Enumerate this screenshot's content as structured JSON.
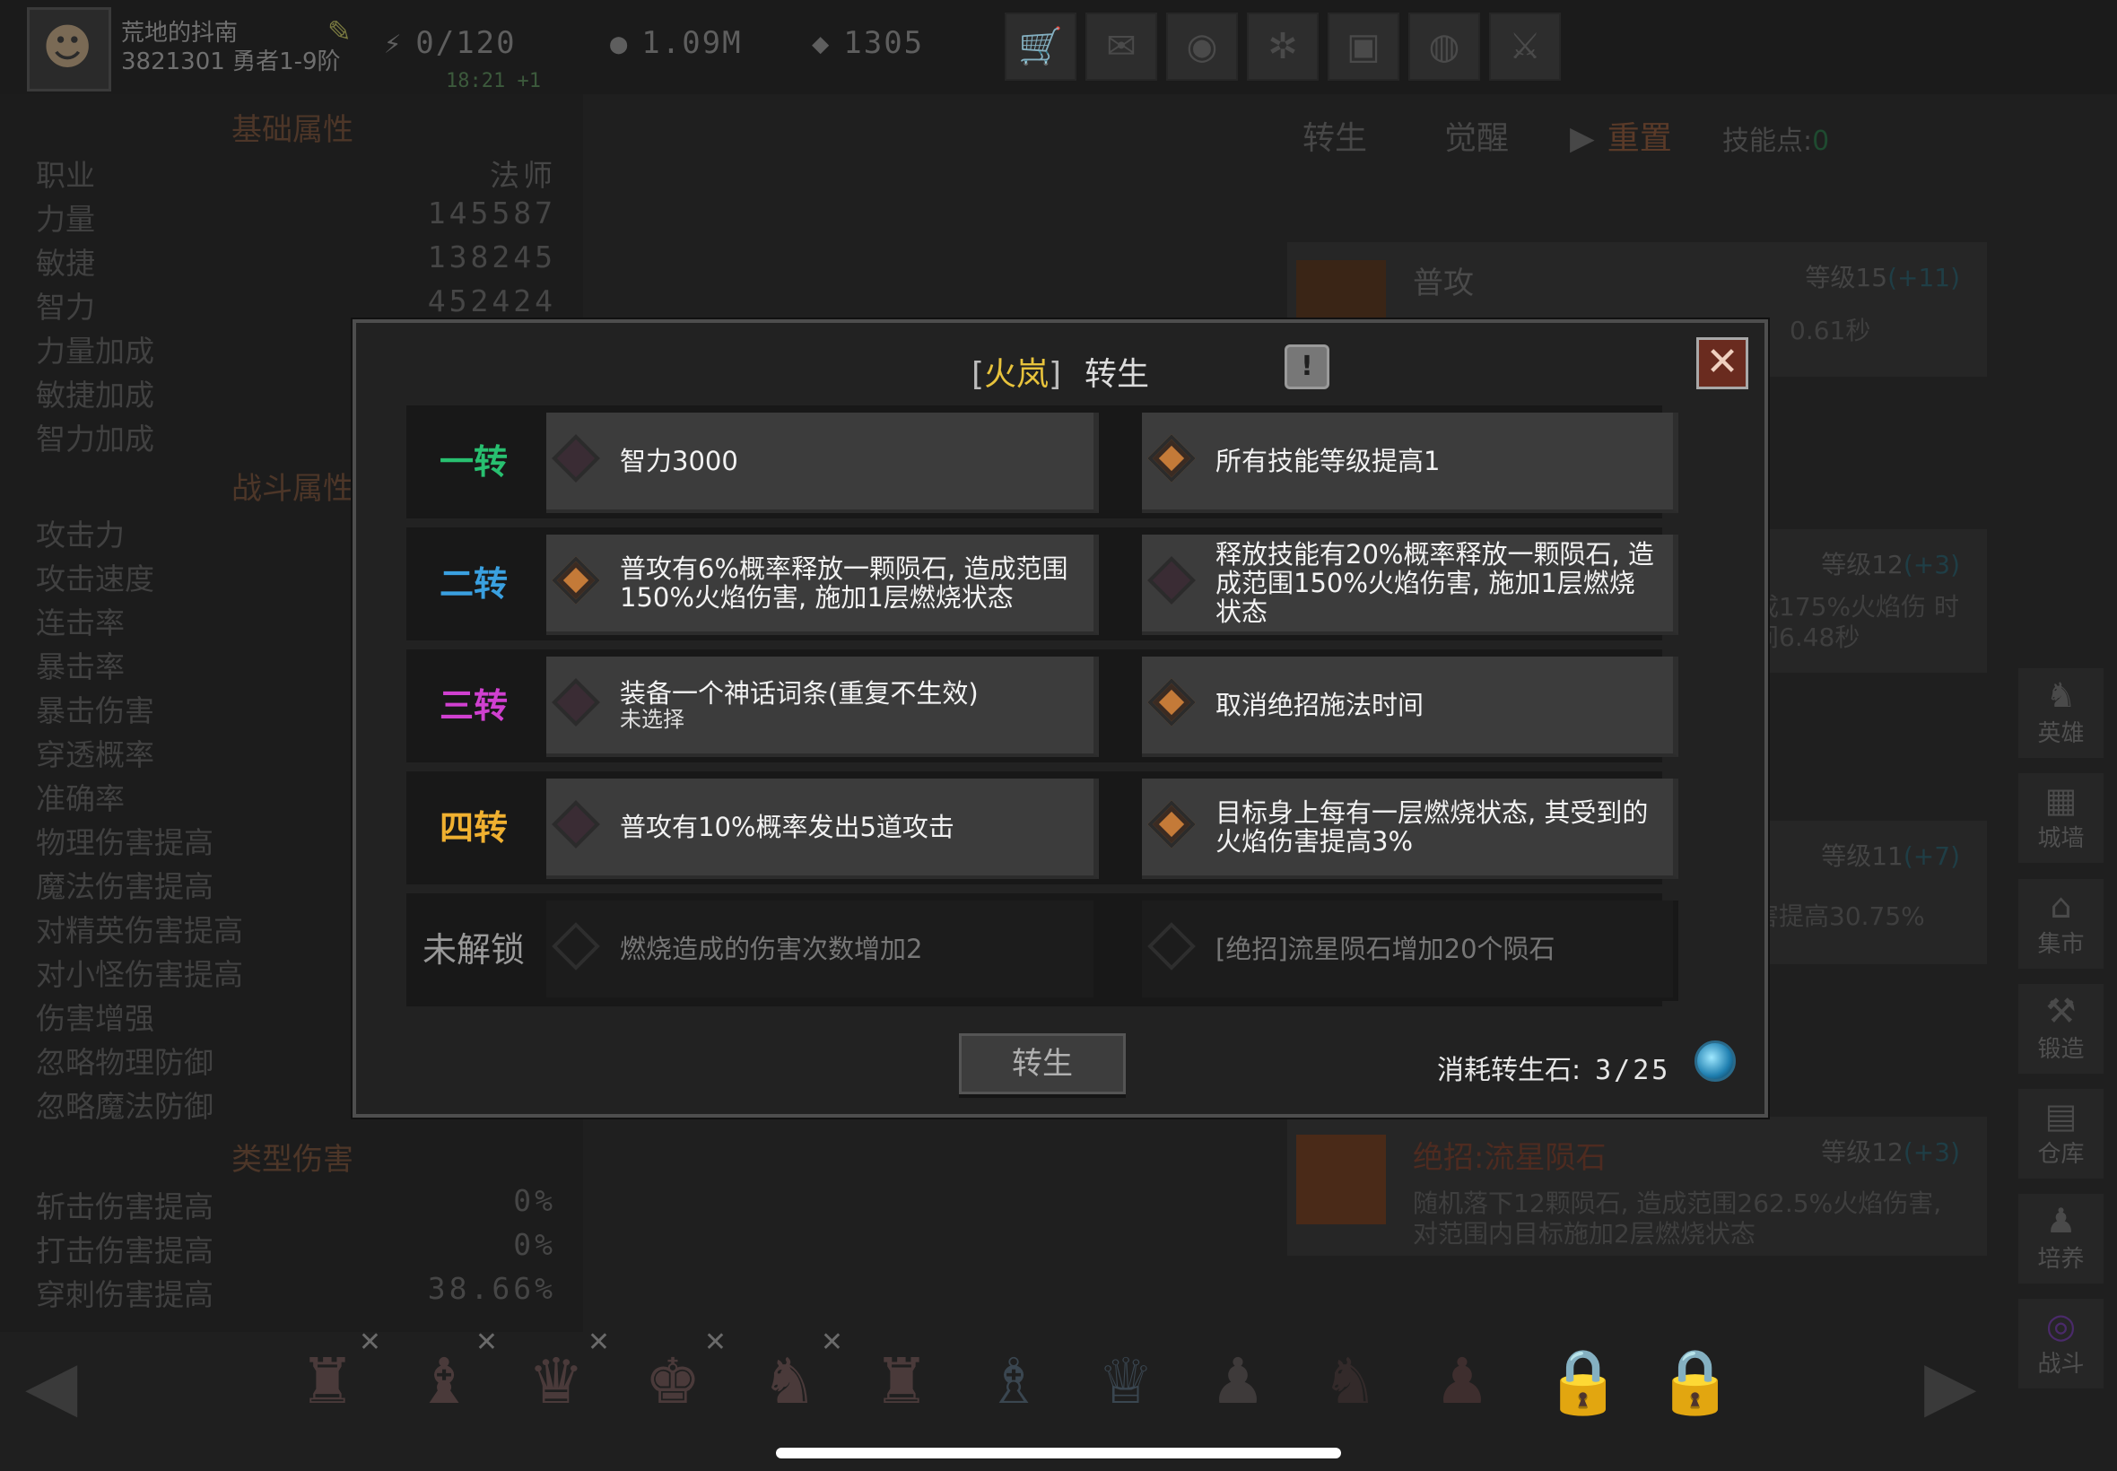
{
  "player": {
    "name": "荒地的抖南",
    "id": "3821301",
    "rank": "勇者1-9阶"
  },
  "resources": {
    "energy": "0/120",
    "energy_timer": "18:21 +1",
    "gold": "1.09M",
    "gems": "1305"
  },
  "toolbar_icons": [
    "shop-icon",
    "mail-icon",
    "gamepad-icon",
    "gear-icon",
    "gift-icon",
    "globe-icon",
    "sword-icon"
  ],
  "left_panel": {
    "basic_title": "基础属性",
    "basic": [
      {
        "label": "职业",
        "value": "法师"
      },
      {
        "label": "力量",
        "value": "145587"
      },
      {
        "label": "敏捷",
        "value": "138245"
      },
      {
        "label": "智力",
        "value": "452424"
      },
      {
        "label": "力量加成",
        "value": ""
      },
      {
        "label": "敏捷加成",
        "value": ""
      },
      {
        "label": "智力加成",
        "value": ""
      }
    ],
    "combat_title": "战斗属性",
    "combat": [
      "攻击力",
      "攻击速度",
      "连击率",
      "暴击率",
      "暴击伤害",
      "穿透概率",
      "准确率",
      "物理伤害提高",
      "魔法伤害提高",
      "对精英伤害提高",
      "对小怪伤害提高",
      "伤害增强",
      "忽略物理防御",
      "忽略魔法防御"
    ],
    "type_title": "类型伤害",
    "type": [
      {
        "label": "斩击伤害提高",
        "value": "0%"
      },
      {
        "label": "打击伤害提高",
        "value": "0%"
      },
      {
        "label": "穿刺伤害提高",
        "value": "38.66%"
      }
    ]
  },
  "right_panel": {
    "tabs": [
      "转生",
      "觉醒",
      "重置"
    ],
    "skill_points_label": "技能点:",
    "skill_points": "0",
    "skills": [
      {
        "name": "普攻",
        "level": "等级15",
        "bonus": "(+11)",
        "desc": "0.61秒"
      },
      {
        "name": "",
        "level": "等级12",
        "bonus": "(+3)",
        "desc": "成175%火焰伤 时间6.48秒"
      },
      {
        "name": "",
        "level": "等级11",
        "bonus": "(+7)",
        "desc": "害提高30.75%"
      },
      {
        "name": "绝招:流星陨石",
        "level": "等级12",
        "bonus": "(+3)",
        "desc": "随机落下12颗陨石, 造成范围262.5%火焰伤害, 对范围内目标施加2层燃烧状态"
      }
    ],
    "side_buttons": [
      "英雄",
      "城墙",
      "集市",
      "锻造",
      "仓库",
      "培养",
      "战斗"
    ]
  },
  "modal": {
    "title_class": "火岚",
    "title_bracket_l": "[",
    "title_bracket_r": "]",
    "title_action": "转生",
    "tiers": [
      {
        "label": "一转",
        "color": "#28c070",
        "a": "智力3000",
        "a_on": false,
        "b": "所有技能等级提高1",
        "b_on": true
      },
      {
        "label": "二转",
        "color": "#3aa0e0",
        "a": "普攻有6%概率释放一颗陨石, 造成范围150%火焰伤害, 施加1层燃烧状态",
        "a_on": true,
        "b": "释放技能有20%概率释放一颗陨石, 造成范围150%火焰伤害, 施加1层燃烧状态",
        "b_on": false
      },
      {
        "label": "三转",
        "color": "#d040d0",
        "a": "装备一个神话词条(重复不生效)",
        "a_sub": "未选择",
        "a_on": false,
        "b": "取消绝招施法时间",
        "b_on": true
      },
      {
        "label": "四转",
        "color": "#f0b030",
        "a": "普攻有10%概率发出5道攻击",
        "a_on": false,
        "b": "目标身上每有一层燃烧状态, 其受到的火焰伤害提高3%",
        "b_on": true
      },
      {
        "label": "未解锁",
        "color": "#999999",
        "a": "燃烧造成的伤害次数增加2",
        "a_on": false,
        "b": "[绝招]流星陨石增加20个陨石",
        "b_on": false
      }
    ],
    "reborn_button": "转生",
    "cost_label": "消耗转生石:",
    "cost_value": "3/25"
  }
}
